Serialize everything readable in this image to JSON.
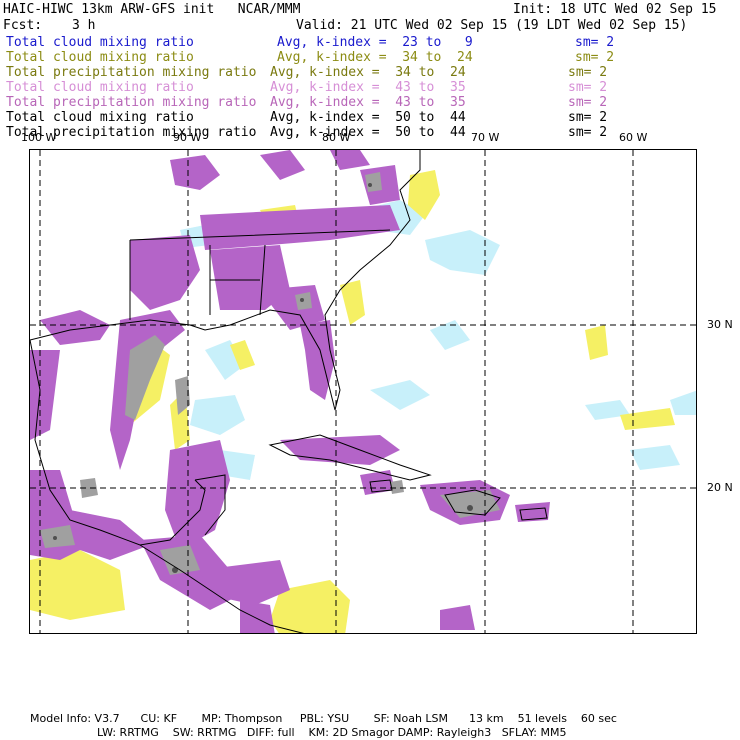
{
  "header": {
    "title": "HAIC-HIWC 13km ARW-GFS init   NCAR/MMM",
    "init": "Init: 18 UTC Wed 02 Sep 15",
    "fcst_label": "Fcst:",
    "fcst_value": "3 h",
    "valid": "Valid: 21 UTC Wed 02 Sep 15 (19 LDT Wed 02 Sep 15)"
  },
  "fields": [
    {
      "name": "Total cloud mixing ratio",
      "avg": "Avg, k-index =  23 to   9",
      "sm": "sm= 2",
      "color": "#1a1acd"
    },
    {
      "name": "Total cloud mixing ratio",
      "avg": "Avg, k-index =  34 to  24",
      "sm": "sm= 2",
      "color": "#8c8c14"
    },
    {
      "name": "Total precipitation mixing ratio",
      "avg": "Avg, k-index =  34 to  24",
      "sm": "sm= 2",
      "color": "#7a7a10"
    },
    {
      "name": "Total cloud mixing ratio",
      "avg": "Avg, k-index =  43 to  35",
      "sm": "sm= 2",
      "color": "#d68fd6"
    },
    {
      "name": "Total precipitation mixing ratio",
      "avg": "Avg, k-index =  43 to  35",
      "sm": "sm= 2",
      "color": "#b866b8"
    },
    {
      "name": "Total cloud mixing ratio",
      "avg": "Avg, k-index =  50 to  44",
      "sm": "sm= 2",
      "color": "#000000"
    },
    {
      "name": "Total precipitation mixing ratio",
      "avg": "Avg, k-index =  50 to  44",
      "sm": "sm= 2",
      "color": "#000000"
    }
  ],
  "map": {
    "lon_labels": [
      "100 W",
      "90 W",
      "80 W",
      "70 W",
      "60 W"
    ],
    "lat_labels": [
      "30 N",
      "20 N"
    ],
    "colors": {
      "cloud_low": "#c8f0fa",
      "cloud_mid": "#f5f064",
      "precip_mid": "#b464c8",
      "cloud_high": "#a0a0a0",
      "precip_high": "#505050",
      "coast": "#000000",
      "grid": "#000000"
    }
  },
  "footer": {
    "line1": "Model Info: V3.7      CU: KF       MP: Thompson     PBL: YSU       SF: Noah LSM      13 km    51 levels    60 sec",
    "line2": "LW: RRTMG    SW: RRTMG   DIFF: full    KM: 2D Smagor DAMP: Rayleigh3   SFLAY: MM5"
  }
}
